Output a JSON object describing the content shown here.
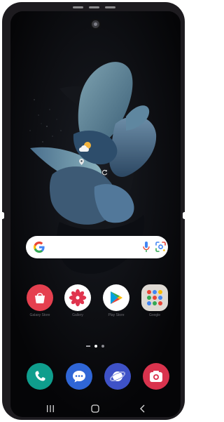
{
  "colors": {
    "device_body": "#1d1b1f",
    "screen_bg": "#050507",
    "search_bar": "#ffffff",
    "galaxy_store": "#e5404f",
    "gallery": "#ffffff",
    "play_store": "#ffffff",
    "google_folder": "#ded9d3",
    "phone": "#0f9e8d",
    "messages": "#2f66d6",
    "internet": "#3e52c7",
    "camera": "#d9334d"
  },
  "home_apps": [
    {
      "name": "galaxy-store-app",
      "label": "Galaxy Store",
      "icon": "galaxy-store-icon"
    },
    {
      "name": "gallery-app",
      "label": "Gallery",
      "icon": "gallery-icon"
    },
    {
      "name": "play-store-app",
      "label": "Play Store",
      "icon": "play-store-icon"
    },
    {
      "name": "google-folder",
      "label": "Google",
      "icon": "google-folder-icon"
    }
  ],
  "dock_apps": [
    {
      "name": "phone-app",
      "icon": "phone-icon"
    },
    {
      "name": "messages-app",
      "icon": "messages-icon"
    },
    {
      "name": "internet-app",
      "icon": "internet-icon"
    },
    {
      "name": "camera-app",
      "icon": "camera-icon"
    }
  ],
  "page_indicator": {
    "pages": 2,
    "current": 1
  },
  "nav_buttons": [
    "recents",
    "home",
    "back"
  ]
}
